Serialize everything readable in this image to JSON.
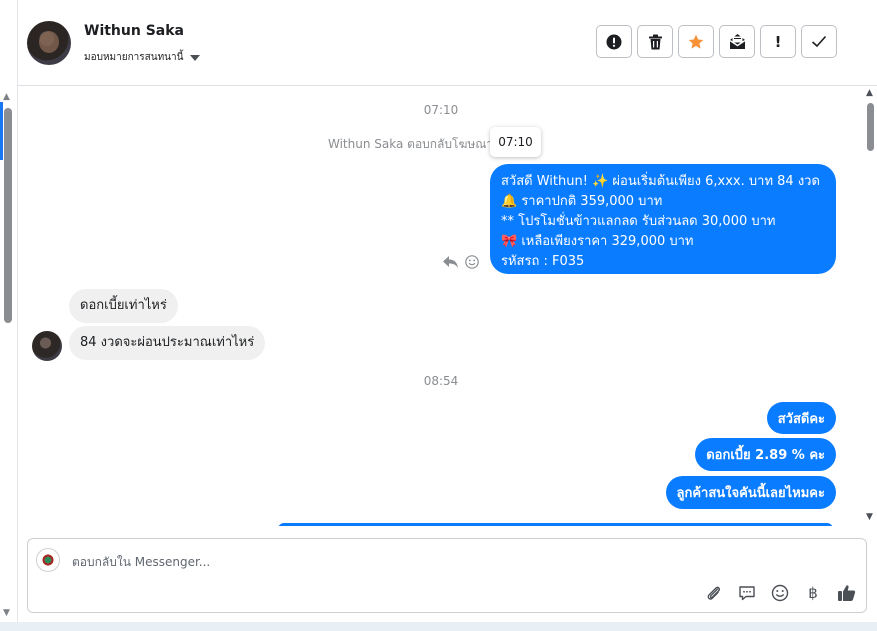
{
  "header": {
    "contact_name": "Withun Saka",
    "assign_label": "มอบหมายการสนทนานี้",
    "toolbar": [
      {
        "name": "report-spam",
        "icon": "exclamation-circle-icon"
      },
      {
        "name": "delete",
        "icon": "trash-icon"
      },
      {
        "name": "star",
        "icon": "star-icon",
        "color": "#f7923b"
      },
      {
        "name": "mark-unread",
        "icon": "open-envelope-icon"
      },
      {
        "name": "follow-up",
        "icon": "exclamation-icon",
        "label": "!"
      },
      {
        "name": "mark-done",
        "icon": "check-icon"
      }
    ]
  },
  "thread": {
    "timestamp_1": "07:10",
    "system_text": "Withun Saka ตอบกลับโฆษณา",
    "tooltip_time": "07:10",
    "ad_reply": {
      "lines": [
        "สวัสดี Withun! ✨  ผ่อนเริ่มต้นเพียง 6,xxx. บาท 84 งวด",
        "🔔 ราคาปกติ  359,000 บาท",
        "** โปรโมชั่นข้าวแลกลด รับส่วนลด 30,000 บาท",
        "🎀  เหลือเพียงราคา 329,000 บาท",
        " รหัสรถ : F035"
      ]
    },
    "incoming": [
      "ดอกเบี้ยเท่าไหร่",
      "84 งวดจะผ่อนประมาณเท่าไหร่"
    ],
    "timestamp_2": "08:54",
    "outgoing": [
      "สวัสดีคะ",
      "ดอกเบี้ย 2.89 % คะ",
      "ลูกค้าสนใจคันนี้เลยไหมคะ"
    ]
  },
  "composer": {
    "placeholder": "ตอบกลับใน Messenger...",
    "actions": [
      "paperclip-icon",
      "saved-reply-icon",
      "emoji-icon",
      "baht-icon",
      "thumbs-up-icon"
    ],
    "baht_symbol": "฿"
  },
  "colors": {
    "outgoing_bubble": "#0a7cff",
    "incoming_bubble": "#f0f0f0",
    "accent": "#1877f2"
  }
}
